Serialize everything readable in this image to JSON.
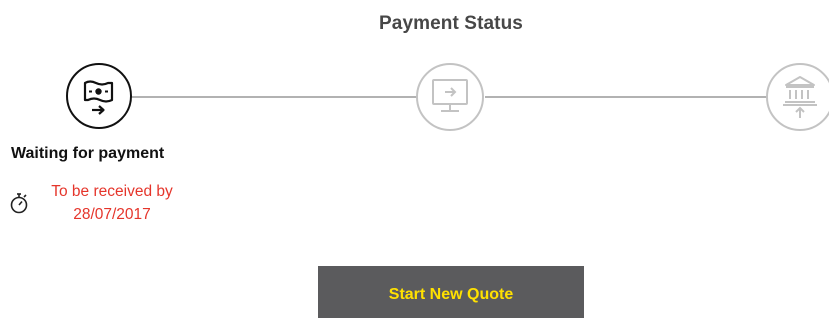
{
  "header": {
    "title": "Payment Status"
  },
  "steps": [
    {
      "icon": "cash-transfer-icon",
      "state": "active"
    },
    {
      "icon": "computer-transfer-icon",
      "state": "inactive"
    },
    {
      "icon": "bank-deposit-icon",
      "state": "inactive"
    }
  ],
  "current_step": {
    "label": "Waiting for payment",
    "due_prefix": "To be received by",
    "due_date": "28/07/2017",
    "timer_icon": "stopwatch-icon",
    "due_color": "#e5352b"
  },
  "actions": {
    "start_quote_label": "Start New Quote",
    "button_bg": "#5b5b5d",
    "button_text_color": "#ffe100"
  }
}
